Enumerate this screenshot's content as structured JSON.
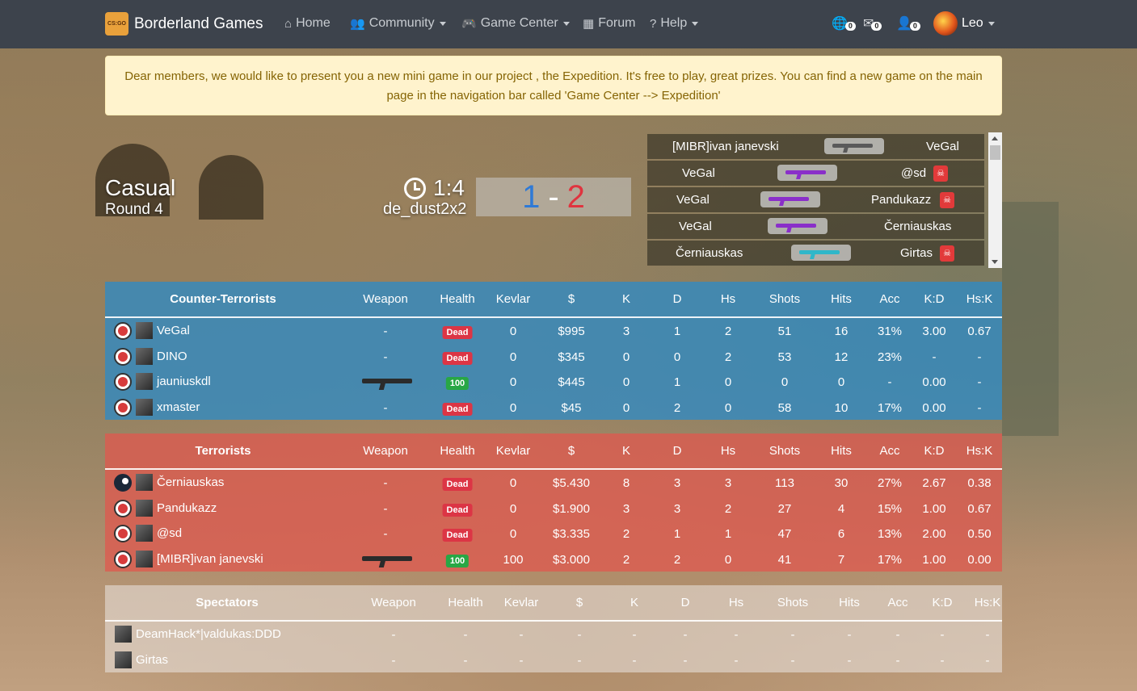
{
  "nav": {
    "brand": "Borderland Games",
    "brand_logo_text": "CS:GO",
    "items": [
      {
        "label": "Home",
        "icon": "home-icon",
        "glyph": "⌂",
        "dropdown": false
      },
      {
        "label": "Community",
        "icon": "users-icon",
        "glyph": "👥",
        "dropdown": true
      },
      {
        "label": "Game Center",
        "icon": "gamepad-icon",
        "glyph": "🎮",
        "dropdown": true
      },
      {
        "label": "Forum",
        "icon": "table-icon",
        "glyph": "▦",
        "dropdown": false
      },
      {
        "label": "Help",
        "icon": "question-icon",
        "glyph": "?",
        "dropdown": true
      }
    ],
    "notifications": [
      {
        "icon": "globe-icon",
        "glyph": "🌐",
        "count": "0"
      },
      {
        "icon": "envelope-icon",
        "glyph": "✉",
        "count": "0"
      },
      {
        "icon": "user-icon",
        "glyph": "👤",
        "count": "0"
      }
    ],
    "user": "Leo"
  },
  "alert": "Dear members, we would like to present you a new mini game in our project , the Expedition. It's free to play, great prizes. You can find a new game on the main page in the navigation bar called 'Game Center --> Expedition'",
  "match": {
    "mode": "Casual",
    "round": "Round 4",
    "time": "1:4",
    "map": "de_dust2x2",
    "score_ct": "1",
    "score_dash": "-",
    "score_t": "2"
  },
  "killfeed": [
    {
      "killer": "[MIBR]ivan janevski",
      "victim": "VeGal",
      "headshot": false,
      "gun_color": "#5a5a5a"
    },
    {
      "killer": "VeGal",
      "victim": "@sd",
      "headshot": true,
      "gun_color": "#8a2fc9"
    },
    {
      "killer": "VeGal",
      "victim": "Pandukazz",
      "headshot": true,
      "gun_color": "#8a2fc9"
    },
    {
      "killer": "VeGal",
      "victim": "Černiauskas",
      "headshot": false,
      "gun_color": "#8a2fc9"
    },
    {
      "killer": "Černiauskas",
      "victim": "Girtas",
      "headshot": true,
      "gun_color": "#2fb7c9"
    }
  ],
  "columns": [
    "Weapon",
    "Health",
    "Kevlar",
    "$",
    "K",
    "D",
    "Hs",
    "Shots",
    "Hits",
    "Acc",
    "K:D",
    "Hs:K"
  ],
  "teams": {
    "ct": {
      "name": "Counter-Terrorists",
      "players": [
        {
          "name": "VeGal",
          "weapon": "-",
          "health": "Dead",
          "kevlar": "0",
          "money": "$995",
          "k": "3",
          "d": "1",
          "hs": "2",
          "shots": "51",
          "hits": "16",
          "acc": "31%",
          "kd": "3.00",
          "hsk": "0.67"
        },
        {
          "name": "DINO",
          "weapon": "-",
          "health": "Dead",
          "kevlar": "0",
          "money": "$345",
          "k": "0",
          "d": "0",
          "hs": "2",
          "shots": "53",
          "hits": "12",
          "acc": "23%",
          "kd": "-",
          "hsk": "-"
        },
        {
          "name": "jauniuskdl",
          "weapon": "",
          "health": "100",
          "kevlar": "0",
          "money": "$445",
          "k": "0",
          "d": "1",
          "hs": "0",
          "shots": "0",
          "hits": "0",
          "acc": "-",
          "kd": "0.00",
          "hsk": "-"
        },
        {
          "name": "xmaster",
          "weapon": "-",
          "health": "Dead",
          "kevlar": "0",
          "money": "$45",
          "k": "0",
          "d": "2",
          "hs": "0",
          "shots": "58",
          "hits": "10",
          "acc": "17%",
          "kd": "0.00",
          "hsk": "-"
        }
      ]
    },
    "t": {
      "name": "Terrorists",
      "players": [
        {
          "name": "Černiauskas",
          "weapon": "-",
          "health": "Dead",
          "kevlar": "0",
          "money": "$5.430",
          "k": "8",
          "d": "3",
          "hs": "3",
          "shots": "113",
          "hits": "30",
          "acc": "27%",
          "kd": "2.67",
          "hsk": "0.38"
        },
        {
          "name": "Pandukazz",
          "weapon": "-",
          "health": "Dead",
          "kevlar": "0",
          "money": "$1.900",
          "k": "3",
          "d": "3",
          "hs": "2",
          "shots": "27",
          "hits": "4",
          "acc": "15%",
          "kd": "1.00",
          "hsk": "0.67"
        },
        {
          "name": "@sd",
          "weapon": "-",
          "health": "Dead",
          "kevlar": "0",
          "money": "$3.335",
          "k": "2",
          "d": "1",
          "hs": "1",
          "shots": "47",
          "hits": "6",
          "acc": "13%",
          "kd": "2.00",
          "hsk": "0.50"
        },
        {
          "name": "[MIBR]ivan janevski",
          "weapon": "",
          "health": "100",
          "kevlar": "100",
          "money": "$3.000",
          "k": "2",
          "d": "2",
          "hs": "0",
          "shots": "41",
          "hits": "7",
          "acc": "17%",
          "kd": "1.00",
          "hsk": "0.00"
        }
      ]
    },
    "spec": {
      "name": "Spectators",
      "players": [
        {
          "name": "DeamHack*|valdukas:DDD",
          "weapon": "-",
          "health": "-",
          "kevlar": "-",
          "money": "-",
          "k": "-",
          "d": "-",
          "hs": "-",
          "shots": "-",
          "hits": "-",
          "acc": "-",
          "kd": "-",
          "hsk": "-"
        },
        {
          "name": "Girtas",
          "weapon": "-",
          "health": "-",
          "kevlar": "-",
          "money": "-",
          "k": "-",
          "d": "-",
          "hs": "-",
          "shots": "-",
          "hits": "-",
          "acc": "-",
          "kd": "-",
          "hsk": "-"
        }
      ]
    }
  },
  "colors": {
    "ct_blue": "#2f7ad6",
    "t_red": "#e0343f",
    "dead": "#dc3545",
    "alive": "#28a745"
  }
}
